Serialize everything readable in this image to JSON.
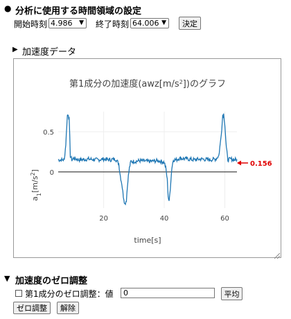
{
  "time_settings": {
    "bullet": "●",
    "title": "分析に使用する時間領域の設定",
    "start_label": "開始時刻",
    "start_value": "4.986",
    "end_label": "終了時刻",
    "end_value": "64.006",
    "confirm_button": "決定"
  },
  "accel_section": {
    "toggle": "▶",
    "label": "加速度データ"
  },
  "chart": {
    "title_main": "第1成分の加速度(awz[m/s",
    "title_sup": "2",
    "title_end": "])のグラフ",
    "ylabel_main": "a",
    "ylabel_sub": "1",
    "ylabel_rest": "[m/s",
    "ylabel_sup": "2",
    "ylabel_end": "]",
    "xlabel": "time[s]",
    "current_value_label": "0.156",
    "chart_data": {
      "type": "line",
      "x_ticks": [
        20,
        40,
        60
      ],
      "y_ticks": [
        0,
        0.5
      ],
      "xlim": [
        4.986,
        64.006
      ],
      "ylim": [
        -0.45,
        0.75
      ],
      "series": [
        {
          "color": "#1f77b4",
          "x": [
            4.986,
            6,
            7,
            7.5,
            8,
            8.3,
            8.6,
            9,
            9.5,
            10,
            12,
            15,
            18,
            20,
            22,
            24,
            25,
            25.5,
            26,
            26.5,
            27,
            27.5,
            28,
            28.5,
            29,
            30,
            32,
            35,
            38,
            40,
            40.5,
            41,
            41.3,
            41.6,
            42,
            42.5,
            43,
            44,
            45,
            48,
            50,
            52,
            55,
            57,
            58,
            58.5,
            59,
            59.3,
            59.6,
            60,
            60.5,
            61,
            62,
            63,
            64.006
          ],
          "y": [
            0.15,
            0.15,
            0.15,
            0.35,
            0.7,
            0.72,
            0.65,
            0.2,
            0.15,
            0.17,
            0.15,
            0.16,
            0.15,
            0.16,
            0.15,
            0.16,
            0.1,
            -0.05,
            -0.15,
            -0.3,
            -0.4,
            -0.35,
            -0.1,
            0.05,
            0.13,
            0.13,
            0.14,
            0.13,
            0.14,
            0.12,
            0.05,
            -0.1,
            -0.3,
            -0.38,
            -0.2,
            0.05,
            0.15,
            0.15,
            0.17,
            0.16,
            0.15,
            0.16,
            0.15,
            0.16,
            0.2,
            0.35,
            0.55,
            0.7,
            0.72,
            0.6,
            0.3,
            0.15,
            0.16,
            0.15,
            0.156
          ]
        }
      ]
    }
  },
  "zero_section": {
    "toggle": "▼",
    "label": "加速度のゼロ調整",
    "checkbox_label": "第1成分のゼロ調整：値",
    "value": "0",
    "average_button": "平均",
    "zero_button": "ゼロ調整",
    "release_button": "解除"
  }
}
